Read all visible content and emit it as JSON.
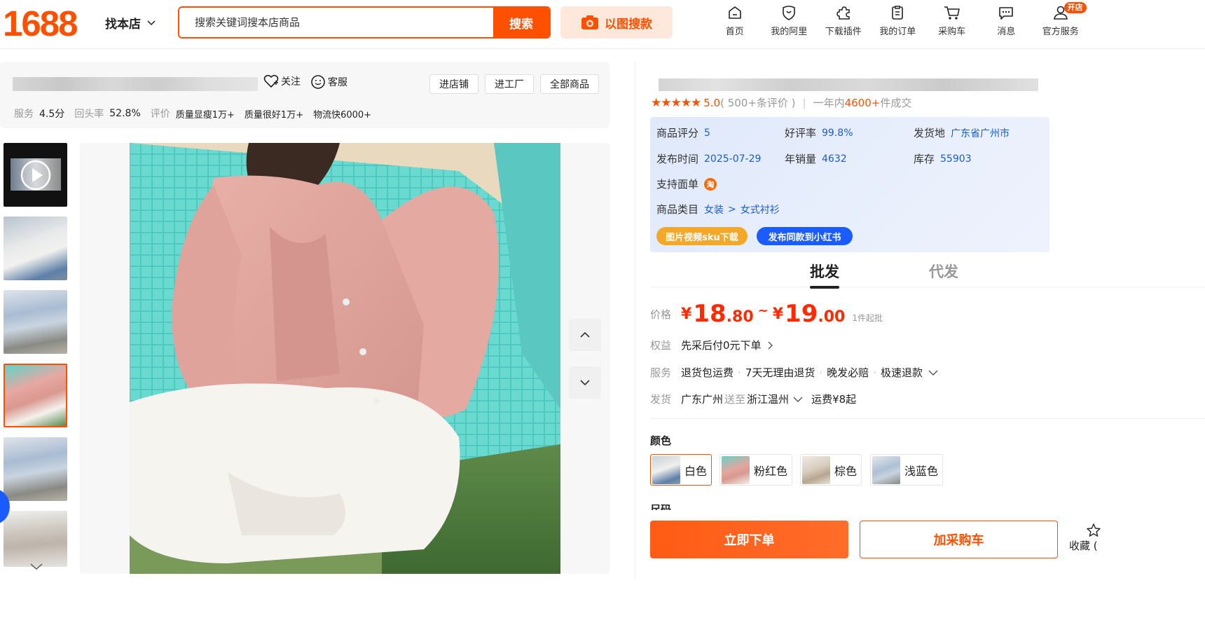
{
  "header": {
    "logo": "1688",
    "find_shop": "找本店",
    "search_placeholder": "搜索关键词搜本店商品",
    "search_button": "搜索",
    "image_search": "以图搜款",
    "nav": [
      {
        "label": "首页",
        "icon": "home-icon"
      },
      {
        "label": "我的阿里",
        "icon": "heart-shield-icon"
      },
      {
        "label": "下载插件",
        "icon": "puzzle-icon"
      },
      {
        "label": "我的订单",
        "icon": "clipboard-icon"
      },
      {
        "label": "采购车",
        "icon": "cart-icon"
      },
      {
        "label": "消息",
        "icon": "message-icon"
      },
      {
        "label": "官方服务",
        "icon": "user-icon",
        "badge": "开店"
      }
    ]
  },
  "shop": {
    "follow": "关注",
    "service": "客服",
    "buttons": [
      "进店铺",
      "进工厂",
      "全部商品"
    ],
    "stats": {
      "service_label": "服务",
      "service_value": "4.5分",
      "repurchase_label": "回头率",
      "repurchase_value": "52.8%",
      "review_label": "评价",
      "tags": [
        "质量显瘦1万+",
        "质量很好1万+",
        "物流快6000+"
      ]
    }
  },
  "product": {
    "rating_score": "5.0",
    "review_count": "( 500+条评价 )",
    "sold_prefix": "一年内",
    "sold_value": "4600+",
    "sold_suffix": " 件成交",
    "info": {
      "score_label": "商品评分",
      "score_value": "5",
      "good_rate_label": "好评率",
      "good_rate_value": "99.8%",
      "ship_from_label": "发货地",
      "ship_from_value": "广东省广州市",
      "publish_label": "发布时间",
      "publish_value": "2025-07-29",
      "annual_sales_label": "年销量",
      "annual_sales_value": "4632",
      "stock_label": "库存",
      "stock_value": "55903",
      "waybill_label": "支持面单",
      "waybill_icon": "淘",
      "category_label": "商品类目",
      "category_1": "女装",
      "category_sep": ">",
      "category_2": "女式衬衫",
      "btn_download": "图片视频sku下载",
      "btn_xhs": "发布同款到小红书"
    },
    "tabs": [
      "批发",
      "代发"
    ],
    "price": {
      "label": "价格",
      "yen": "¥",
      "low_int": "18",
      "low_dec": ".80",
      "tilde": "~",
      "high_int": "19",
      "high_dec": ".00",
      "moq": "1件起批"
    },
    "rights": {
      "label": "权益",
      "value": "先采后付0元下单"
    },
    "services": {
      "label": "服务",
      "items": [
        "退货包运费",
        "7天无理由退货",
        "晚发必赔",
        "极速退款"
      ]
    },
    "shipping": {
      "label": "发货",
      "from": "广东广州",
      "to_label": "送至",
      "to": "浙江温州",
      "fee": "运费¥8起"
    },
    "color_label": "颜色",
    "colors": [
      "白色",
      "粉红色",
      "棕色",
      "浅蓝色"
    ],
    "size_label": "尺码",
    "buy_now": "立即下单",
    "add_cart": "加采购车",
    "favorite": "收藏 ("
  }
}
